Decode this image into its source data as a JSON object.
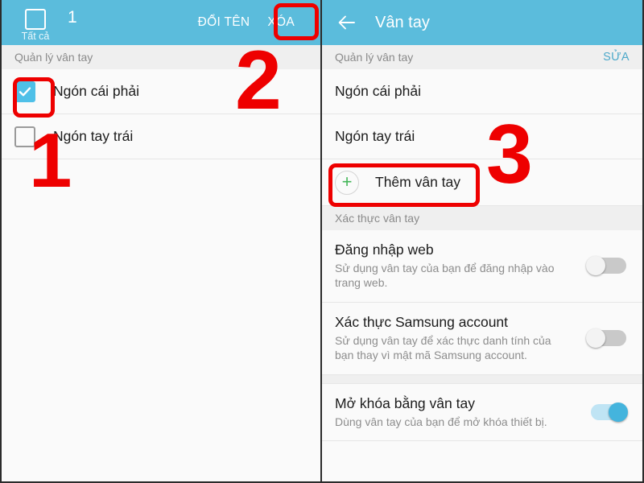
{
  "left_panel": {
    "header": {
      "select_all_label": "Tất cả",
      "selected_count": "1",
      "rename_label": "ĐỔI TÊN",
      "delete_label": "XÓA"
    },
    "section_title": "Quản lý vân tay",
    "items": [
      {
        "label": "Ngón cái phải",
        "checked": true
      },
      {
        "label": "Ngón tay trái",
        "checked": false
      }
    ]
  },
  "right_panel": {
    "header": {
      "back_icon": "arrow-left-icon",
      "title": "Vân tay"
    },
    "manage_section": {
      "title": "Quản lý vân tay",
      "action_label": "SỬA",
      "items": [
        {
          "label": "Ngón cái phải"
        },
        {
          "label": "Ngón tay trái"
        }
      ],
      "add_label": "Thêm vân tay",
      "add_icon": "plus-circle-icon"
    },
    "verify_section": {
      "title": "Xác thực vân tay",
      "settings": [
        {
          "title": "Đăng nhập web",
          "desc": "Sử dụng vân tay của bạn để đăng nhập vào trang web.",
          "enabled": false
        },
        {
          "title": "Xác thực Samsung account",
          "desc": "Sử dụng vân tay để xác thực danh tính của bạn thay vì mật mã Samsung account.",
          "enabled": false
        }
      ]
    },
    "unlock_section": {
      "settings": [
        {
          "title": "Mở khóa bằng vân tay",
          "desc": "Dùng vân tay của bạn để mở khóa thiết bị.",
          "enabled": true
        }
      ]
    }
  },
  "annotations": {
    "step_1": "1",
    "step_2": "2",
    "step_3": "3",
    "color": "#ee0000"
  },
  "colors": {
    "appbar": "#5bbcdc",
    "accent_link": "#4ea9ca",
    "checkbox_checked": "#4fc0e8",
    "toggle_on": "#44b4dd",
    "plus_green": "#43b658",
    "annotation_red": "#ee0000"
  }
}
